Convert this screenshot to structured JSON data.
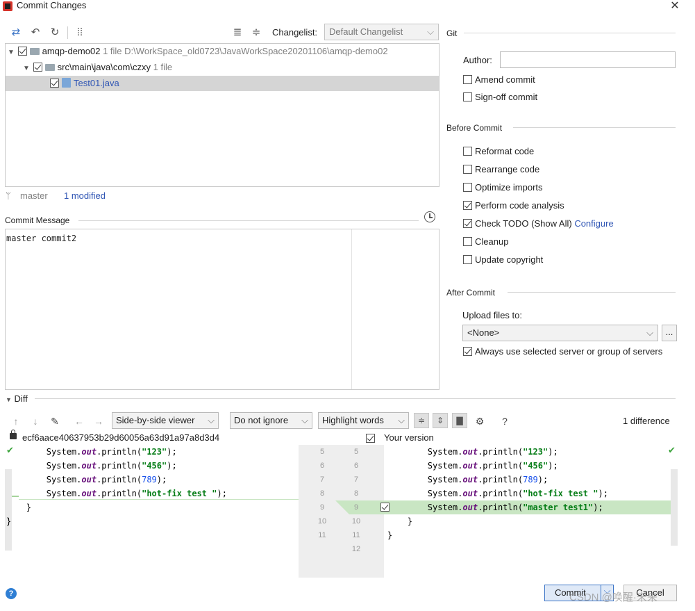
{
  "window": {
    "title": "Commit Changes",
    "close_glyph": "✕"
  },
  "toolbar": {
    "icons": [
      "diff-icon",
      "undo-icon",
      "refresh-icon",
      "group-icon",
      "expand-all-icon",
      "collapse-all-icon"
    ],
    "changelist_label": "Changelist:",
    "changelist_value": "Default Changelist"
  },
  "tree": {
    "root": {
      "name": "amqp-demo02",
      "count": "1 file",
      "path": "D:\\WorkSpace_old0723\\JavaWorkSpace20201106\\amqp-demo02"
    },
    "package": {
      "name": "src\\main\\java\\com\\czxy",
      "count": "1 file"
    },
    "file": {
      "name": "Test01.java"
    }
  },
  "branch": {
    "name": "master",
    "modified": "1 modified"
  },
  "commit_message": {
    "label": "Commit Message",
    "text": "master commit2"
  },
  "git": {
    "title": "Git",
    "author_label": "Author:",
    "author_value": "",
    "amend": "Amend commit",
    "signoff": "Sign-off commit"
  },
  "before_commit": {
    "title": "Before Commit",
    "reformat": "Reformat code",
    "rearrange": "Rearrange code",
    "optimize": "Optimize imports",
    "analysis": "Perform code analysis",
    "todo": "Check TODO (Show All)",
    "configure": "Configure",
    "cleanup": "Cleanup",
    "copyright": "Update copyright"
  },
  "after_commit": {
    "title": "After Commit",
    "upload_label": "Upload files to:",
    "upload_value": "<None>",
    "browse": "...",
    "always_use": "Always use selected server or group of servers"
  },
  "diff": {
    "title": "Diff",
    "viewer": "Side-by-side viewer",
    "ignore": "Do not ignore",
    "highlight": "Highlight words",
    "help": "?",
    "count": "1 difference",
    "left_title": "ecf6aace40637953b29d60056a63d91a97a8d3d4",
    "right_title": "Your version",
    "left_lines": [
      {
        "n": "5",
        "pre": "        System.",
        "kw": "out",
        "mid": ".println(",
        "val": "\"123\"",
        "post": ");",
        "type": "str"
      },
      {
        "n": "6",
        "pre": "        System.",
        "kw": "out",
        "mid": ".println(",
        "val": "\"456\"",
        "post": ");",
        "type": "str"
      },
      {
        "n": "7",
        "pre": "        System.",
        "kw": "out",
        "mid": ".println(",
        "val": "789",
        "post": ");",
        "type": "num"
      },
      {
        "n": "8",
        "pre": "        System.",
        "kw": "out",
        "mid": ".println(",
        "val": "\"hot-fix test \"",
        "post": ");",
        "type": "str"
      },
      {
        "n": "9",
        "pre": "    }",
        "kw": "",
        "mid": "",
        "val": "",
        "post": "",
        "type": ""
      },
      {
        "n": "10",
        "pre": "}",
        "kw": "",
        "mid": "",
        "val": "",
        "post": "",
        "type": ""
      },
      {
        "n": "11",
        "pre": "",
        "kw": "",
        "mid": "",
        "val": "",
        "post": "",
        "type": ""
      }
    ],
    "right_lines": [
      {
        "n": "5",
        "pre": "        System.",
        "kw": "out",
        "mid": ".println(",
        "val": "\"123\"",
        "post": ");",
        "type": "str"
      },
      {
        "n": "6",
        "pre": "        System.",
        "kw": "out",
        "mid": ".println(",
        "val": "\"456\"",
        "post": ");",
        "type": "str"
      },
      {
        "n": "7",
        "pre": "        System.",
        "kw": "out",
        "mid": ".println(",
        "val": "789",
        "post": ");",
        "type": "num"
      },
      {
        "n": "8",
        "pre": "        System.",
        "kw": "out",
        "mid": ".println(",
        "val": "\"hot-fix test \"",
        "post": ");",
        "type": "str"
      },
      {
        "n": "9",
        "pre": "        System.",
        "kw": "out",
        "mid": ".println(",
        "val": "\"master test1\"",
        "post": ");",
        "type": "str"
      },
      {
        "n": "10",
        "pre": "    }",
        "kw": "",
        "mid": "",
        "val": "",
        "post": "",
        "type": ""
      },
      {
        "n": "11",
        "pre": "}",
        "kw": "",
        "mid": "",
        "val": "",
        "post": "",
        "type": ""
      },
      {
        "n": "12",
        "pre": "",
        "kw": "",
        "mid": "",
        "val": "",
        "post": "",
        "type": ""
      }
    ]
  },
  "footer": {
    "help": "?",
    "commit": "Commit",
    "cancel": "Cancel",
    "watermark": "CSDN @唤醒·未来"
  }
}
